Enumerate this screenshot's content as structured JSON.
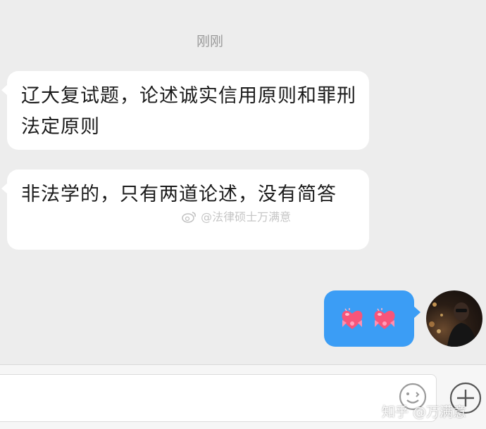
{
  "chat": {
    "timestamp": "刚刚",
    "messages": [
      {
        "text": "辽大复试题，论述诚实信用原则和罪刑法定原则"
      },
      {
        "text": "非法学的，只有两道论述，没有简答"
      }
    ],
    "outgoing": {
      "emojis": [
        "heart-bow-icon",
        "heart-bow-icon"
      ]
    }
  },
  "watermarks": {
    "weibo": "@法律硕士万满意",
    "zhihu": "知乎 @万满意"
  },
  "input_bar": {
    "icons": [
      "emoji-icon",
      "plus-icon"
    ]
  },
  "colors": {
    "background": "#ededed",
    "incoming_bubble": "#ffffff",
    "outgoing_bubble": "#3b9df5",
    "heart": "#f7557a"
  }
}
